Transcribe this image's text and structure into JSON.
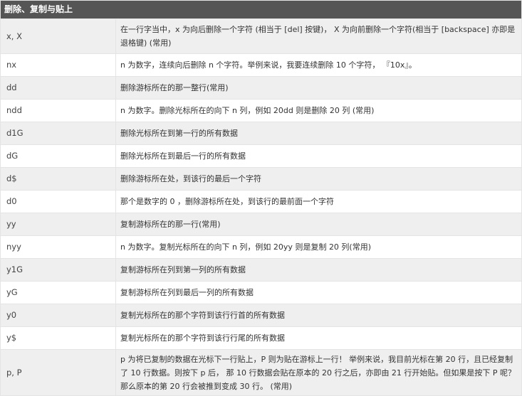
{
  "header": "删除、复制与贴上",
  "rows": [
    {
      "cmd": "x, X",
      "desc": "在一行字当中，x 为向后删除一个字符 (相当于 [del] 按键)， X 为向前删除一个字符(相当于 [backspace] 亦即是退格键) (常用)"
    },
    {
      "cmd": "nx",
      "desc": "n 为数字，连续向后删除 n 个字符。举例来说，我要连续删除 10 个字符， 『10x』。"
    },
    {
      "cmd": "dd",
      "desc": "删除游标所在的那一整行(常用)"
    },
    {
      "cmd": "ndd",
      "desc": "n 为数字。删除光标所在的向下 n 列，例如 20dd 则是删除 20 列 (常用)"
    },
    {
      "cmd": "d1G",
      "desc": "删除光标所在到第一行的所有数据"
    },
    {
      "cmd": "dG",
      "desc": "删除光标所在到最后一行的所有数据"
    },
    {
      "cmd": "d$",
      "desc": "删除游标所在处，到该行的最后一个字符"
    },
    {
      "cmd": "d0",
      "desc": "那个是数字的 0 ，删除游标所在处，到该行的最前面一个字符"
    },
    {
      "cmd": "yy",
      "desc": "复制游标所在的那一行(常用)"
    },
    {
      "cmd": "nyy",
      "desc": "n 为数字。复制光标所在的向下 n 列，例如 20yy 则是复制 20 列(常用)"
    },
    {
      "cmd": "y1G",
      "desc": "复制游标所在列到第一列的所有数据"
    },
    {
      "cmd": "yG",
      "desc": "复制游标所在列到最后一列的所有数据"
    },
    {
      "cmd": "y0",
      "desc": "复制光标所在的那个字符到该行行首的所有数据"
    },
    {
      "cmd": "y$",
      "desc": "复制光标所在的那个字符到该行行尾的所有数据"
    },
    {
      "cmd": "p, P",
      "desc": "p 为将已复制的数据在光标下一行贴上，P 则为贴在游标上一行！ 举例来说，我目前光标在第 20 行，且已经复制了 10 行数据。则按下 p 后， 那 10 行数据会贴在原本的 20 行之后，亦即由 21 行开始贴。但如果是按下 P 呢？ 那么原本的第 20 行会被推到变成 30 行。 (常用)"
    }
  ]
}
